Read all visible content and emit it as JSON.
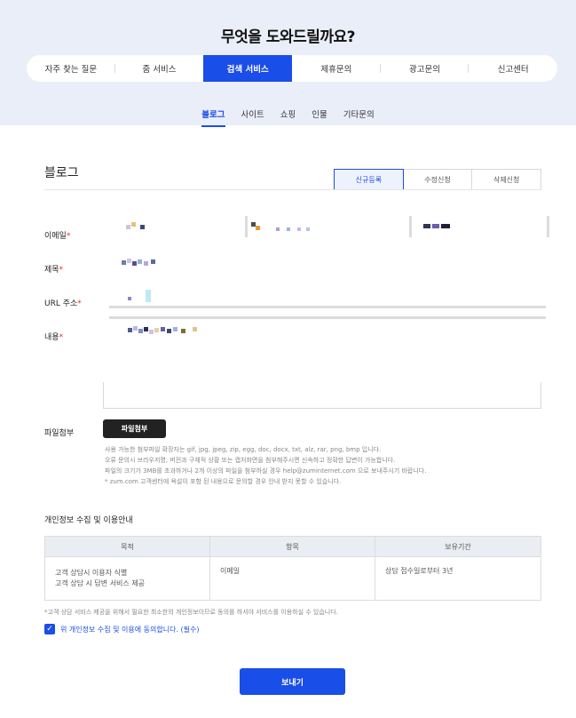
{
  "header": {
    "title": "무엇을 도와드릴까요?",
    "tabs": [
      "자주 찾는 질문",
      "줌 서비스",
      "검색 서비스",
      "제휴문의",
      "광고문의",
      "신고센터"
    ],
    "active_tab": "검색 서비스"
  },
  "sub_tabs": {
    "items": [
      "블로그",
      "사이트",
      "쇼핑",
      "인물",
      "기타문의"
    ],
    "active": "블로그"
  },
  "section": {
    "title": "블로그",
    "request_tabs": [
      "신규등록",
      "수정신청",
      "삭제신청"
    ],
    "active_request": "신규등록"
  },
  "form": {
    "email_label": "이메일",
    "subject_label": "제목",
    "url_label": "URL 주소",
    "content_label": "내용",
    "file_label": "파일첨부",
    "file_button": "파일첨부",
    "file_notes": [
      "사용 가능한 첨부파일 확장자는 gif, jpg, jpeg, zip, egg, doc, docx, txt, alz, rar, png, bmp 입니다.",
      "오류 문의시 브라우저명, 버전과 구체적 상황 또는 캡처화면을 첨부해주시면 신속하고 정확한 답변이 가능합니다.",
      "파일의 크기가 3MB를 초과하거나 2개 이상의 파일을 첨부하실 경우 help@zuminternet.com 으로 보내주시기 바랍니다.",
      "* zum.com 고객센터에 욕설이 포함 된 내용으로 문의할 경우 안내 받지 못할 수 있습니다."
    ]
  },
  "privacy": {
    "title": "개인정보 수집 및 이용안내",
    "headers": [
      "목적",
      "항목",
      "보유기간"
    ],
    "row": {
      "purpose_lines": [
        "고객 상담시 이용자 식별",
        "고객 상담 시 답변 서비스 제공"
      ],
      "item": "이메일",
      "period": "상담 접수일로부터 3년"
    },
    "footnote": "*고객 상담 서비스 제공을 위해서 필요한 최소한의 개인정보이므로 동의를 하셔야 서비스를 이용하실 수 있습니다.",
    "agree_label": "위 개인정보 수집 및 이용에 동의합니다. (필수)"
  },
  "submit_label": "보내기",
  "colors": {
    "accent": "#1a4ee8",
    "hero_bg": "#eaeef8",
    "required": "#e0302a"
  }
}
